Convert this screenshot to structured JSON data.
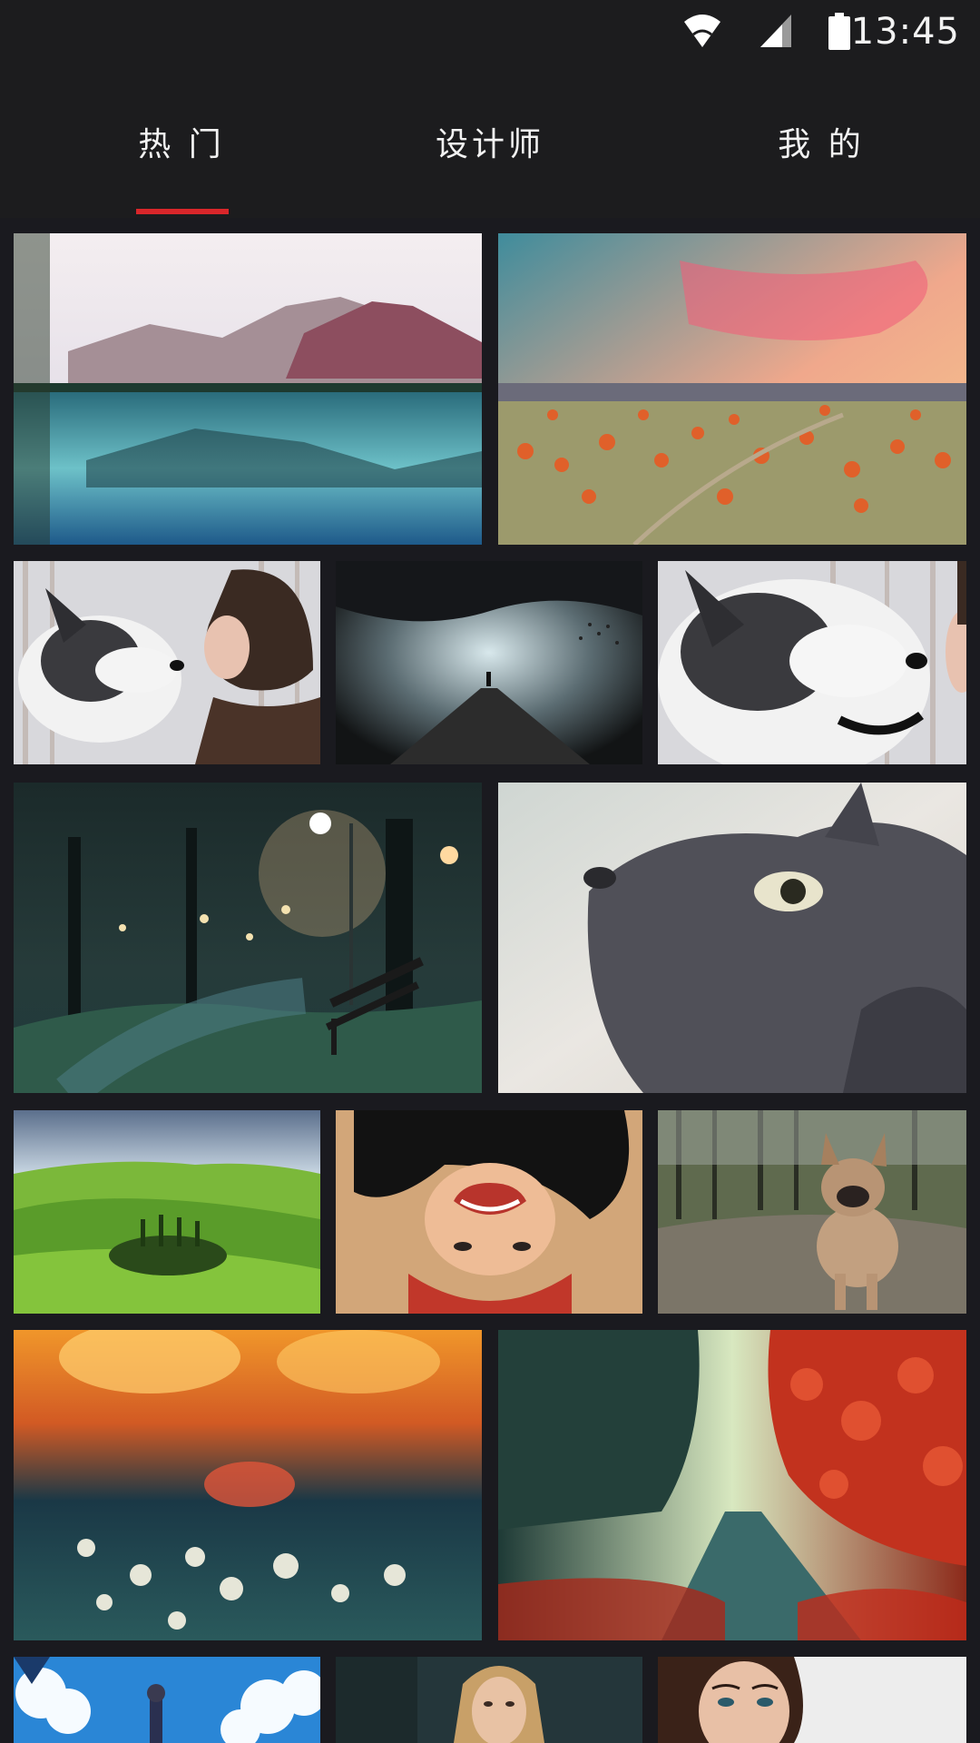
{
  "status_bar": {
    "time": "13:45",
    "icons": [
      "wifi-icon",
      "signal-icon",
      "battery-icon"
    ]
  },
  "tabs": [
    {
      "label": "热 门",
      "active": true
    },
    {
      "label": "设计师",
      "active": false
    },
    {
      "label": "我 的",
      "active": false
    }
  ],
  "colors": {
    "accent": "#d9262a",
    "background": "#1c1c1e"
  },
  "gallery": {
    "items": [
      {
        "subject": "mountain-lake"
      },
      {
        "subject": "sunset-valley"
      },
      {
        "subject": "husky-and-girl"
      },
      {
        "subject": "foggy-pier"
      },
      {
        "subject": "husky-and-girl-2"
      },
      {
        "subject": "night-park-bench"
      },
      {
        "subject": "gray-cat"
      },
      {
        "subject": "green-hills"
      },
      {
        "subject": "upside-down-girl"
      },
      {
        "subject": "french-bulldog"
      },
      {
        "subject": "dandelions-sunset"
      },
      {
        "subject": "red-autumn-road"
      },
      {
        "subject": "anime-sky"
      },
      {
        "subject": "blonde-woman"
      },
      {
        "subject": "brunette-woman"
      }
    ]
  }
}
